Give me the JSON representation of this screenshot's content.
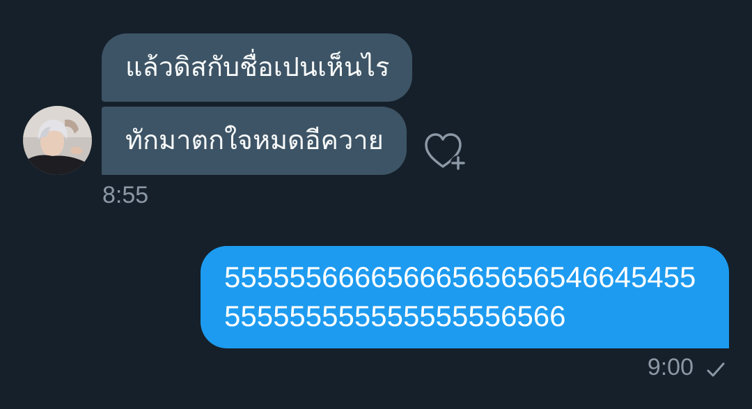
{
  "conversation": {
    "received": {
      "messages": [
        {
          "text": "แล้วดิสกับชื่อเปนเห็นไร"
        },
        {
          "text": "ทักมาตกใจหมดอีควาย"
        }
      ],
      "time": "8:55",
      "avatar_icon": "user-avatar-photo",
      "react_icon": "heart-plus-icon"
    },
    "sent": {
      "text_lines": [
        "55555566665666565656546645455",
        "555555555555555556566"
      ],
      "time": "9:00",
      "status_icon": "check-icon"
    }
  },
  "colors": {
    "background": "#16202a",
    "received_bubble": "#3d5466",
    "sent_bubble": "#1d9bf0",
    "muted_text": "#8b98a5",
    "bubble_text": "#ffffff"
  }
}
